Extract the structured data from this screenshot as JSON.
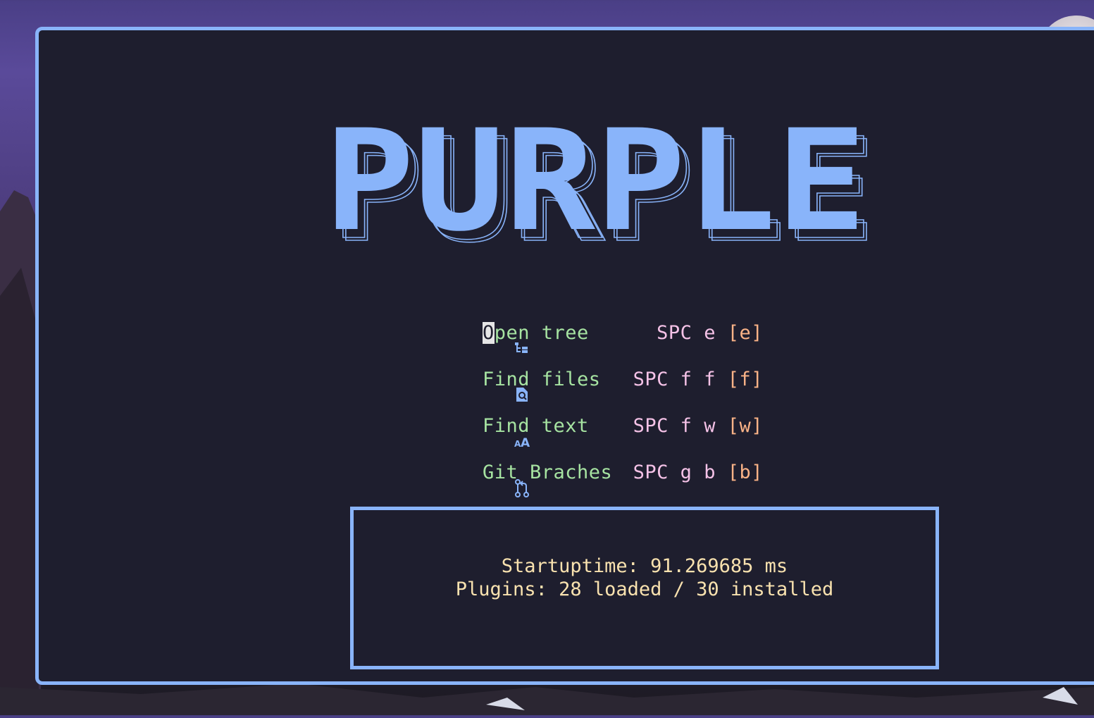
{
  "window": {
    "title": ""
  },
  "logo": {
    "text": "PURPLE"
  },
  "menu": {
    "items": [
      {
        "icon": "file-tree-icon",
        "label_first": "O",
        "label_rest": "pen tree",
        "keys": "SPC e",
        "shortcut": "[e]"
      },
      {
        "icon": "file-search-icon",
        "label_first": "",
        "label_rest": "Find files",
        "keys": "SPC f f",
        "shortcut": "[f]"
      },
      {
        "icon": "font-size-icon",
        "label_first": "",
        "label_rest": "Find text",
        "keys": "SPC f w",
        "shortcut": "[w]"
      },
      {
        "icon": "git-branch-icon",
        "label_first": "",
        "label_rest": "Git Braches",
        "keys": "SPC g b",
        "shortcut": "[b]"
      }
    ]
  },
  "footer": {
    "startuptime": "Startuptime: 91.269685 ms",
    "plugins": "Plugins: 28 loaded / 30 installed"
  },
  "colors": {
    "background": "#1e1e2e",
    "accent": "#89b4fa",
    "label": "#a6e3a1",
    "keys": "#f5c2e7",
    "shortcut": "#fab387",
    "footer_text": "#f9e2af"
  }
}
